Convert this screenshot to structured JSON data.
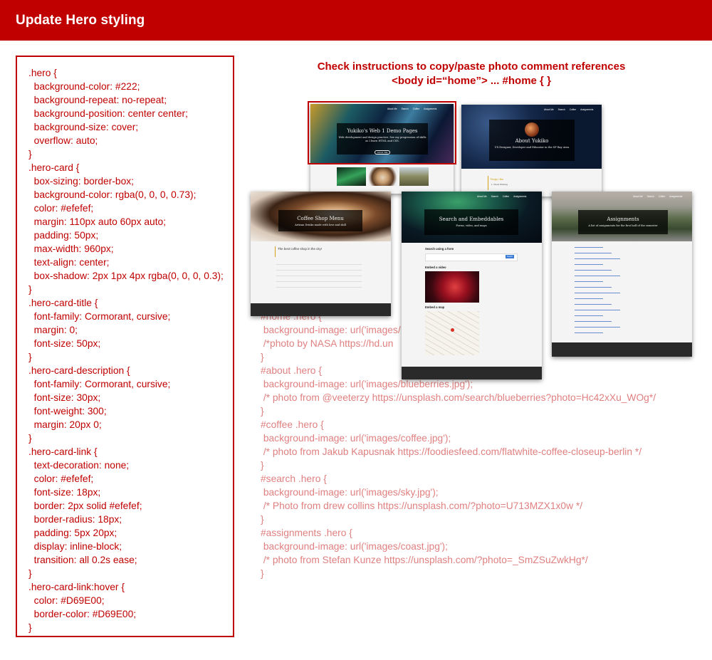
{
  "header": {
    "title": "Update Hero styling"
  },
  "css_code": [
    ".hero {",
    "  background-color: #222;",
    "  background-repeat: no-repeat;",
    "  background-position: center center;",
    "  background-size: cover;",
    "  overflow: auto;",
    "}",
    ".hero-card {",
    "  box-sizing: border-box;",
    "  background-color: rgba(0, 0, 0, 0.73);",
    "  color: #efefef;",
    "  margin: 110px auto 60px auto;",
    "  padding: 50px;",
    "  max-width: 960px;",
    "  text-align: center;",
    "  box-shadow: 2px 1px 4px rgba(0, 0, 0, 0.3);",
    "}",
    ".hero-card-title {",
    "  font-family: Cormorant, cursive;",
    "  margin: 0;",
    "  font-size: 50px;",
    "}",
    ".hero-card-description {",
    "  font-family: Cormorant, cursive;",
    "  font-size: 30px;",
    "  font-weight: 300;",
    "  margin: 20px 0;",
    "}",
    ".hero-card-link {",
    "  text-decoration: none;",
    "  color: #efefef;",
    "  font-size: 18px;",
    "  border: 2px solid #efefef;",
    "  border-radius: 18px;",
    "  padding: 5px 20px;",
    "  display: inline-block;",
    "  transition: all 0.2s ease;",
    "}",
    ".hero-card-link:hover {",
    "  color: #D69E00;",
    "  border-color: #D69E00;",
    "}"
  ],
  "instructions": {
    "line1": "Check instructions to copy/paste photo comment references",
    "line2": "<body id=“home”> ... #home { }"
  },
  "background_code": [
    "#home .hero {",
    " background-image: url('images/",
    " /*photo by NASA https://hd.un",
    "}",
    "#about .hero {",
    " background-image: url('images/blueberries.jpg');",
    " /* photo from @veeterzy https://unsplash.com/search/blueberries?photo=Hc42xXu_WOg*/",
    "}",
    "#coffee .hero {",
    " background-image: url('images/coffee.jpg');",
    " /* photo from Jakub Kapusnak https://foodiesfeed.com/flatwhite-coffee-closeup-berlin */",
    "}",
    "#search .hero {",
    " background-image: url('images/sky.jpg');",
    " /* Photo from drew collins https://unsplash.com/?photo=U713MZX1x0w */",
    "}",
    "#assignments .hero {",
    " background-image: url('images/coast.jpg');",
    " /* photo from Stefan Kunze https://unsplash.com/?photo=_SmZSuZwkHg*/",
    "}"
  ],
  "thumbnails": {
    "home": {
      "title": "Yukiko's Web 1 Demo Pages",
      "desc": "Web development and design practice. See my progression of skills as I learn HTML and CSS.",
      "link": "About Me"
    },
    "about": {
      "title": "About Yukiko",
      "desc": "UX Designer, Developer and Educator in the SF Bay Area",
      "section": "Things I like",
      "item": "1. Wood Working"
    },
    "coffee": {
      "title": "Coffee Shop Menu",
      "desc": "Artisan Drinks made with love and skill",
      "menu_heading": "The best coffee shop in the city!"
    },
    "search": {
      "title": "Search and Embeddables",
      "desc": "Forms, video, and maps",
      "form_heading": "Search using a form",
      "video_heading": "Embed a video",
      "map_heading": "Embed a map",
      "button": "Search"
    },
    "assignments": {
      "title": "Assignments",
      "desc": "A list of assignments for the first half of the semester"
    },
    "nav": [
      "About Me",
      "Search",
      "Coffee",
      "Assignments"
    ]
  }
}
